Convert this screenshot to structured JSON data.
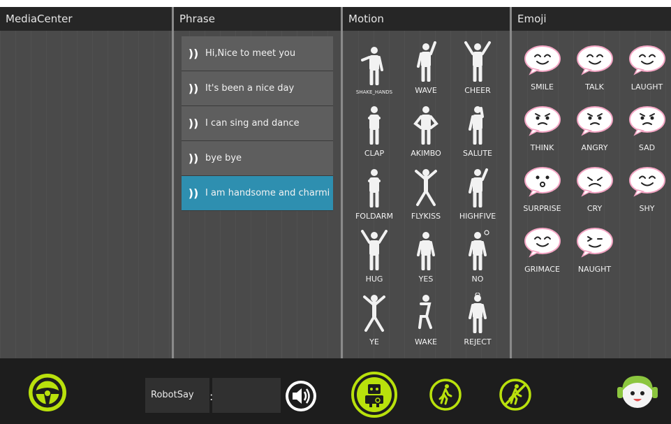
{
  "panes": {
    "media": {
      "title": "MediaCenter"
    },
    "phrase": {
      "title": "Phrase"
    },
    "motion": {
      "title": "Motion"
    },
    "emoji": {
      "title": "Emoji"
    }
  },
  "phrases": [
    {
      "text": "Hi,Nice to meet you",
      "selected": false
    },
    {
      "text": "It's been a nice day",
      "selected": false
    },
    {
      "text": "I can sing and dance",
      "selected": false
    },
    {
      "text": "bye bye",
      "selected": false
    },
    {
      "text": "I am handsome and charming",
      "selected": true
    }
  ],
  "motions": [
    "SHAKE_HANDS",
    "WAVE",
    "CHEER",
    "CLAP",
    "AKIMBO",
    "SALUTE",
    "FOLDARM",
    "FLYKISS",
    "HIGHFIVE",
    "HUG",
    "YES",
    "NO",
    "YE",
    "WAKE",
    "REJECT"
  ],
  "emojis": [
    "SMILE",
    "TALK",
    "LAUGHT",
    "THINK",
    "ANGRY",
    "SAD",
    "SURPRISE",
    "CRY",
    "SHY",
    "GRIMACE",
    "NAUGHT"
  ],
  "bottom": {
    "robotsay_label": "RobotSay",
    "robotsay_separator": ":",
    "robotsay_value": "",
    "icons": {
      "steering": "steering-wheel-icon",
      "volume": "speaker-icon",
      "robot": "robot-icon",
      "walk": "walk-icon",
      "no_walk": "no-walk-icon",
      "avatar": "robot-head-icon"
    }
  },
  "colors": {
    "accent": "#b9e10c",
    "selected": "#2e8fb0",
    "header": "#262626"
  }
}
